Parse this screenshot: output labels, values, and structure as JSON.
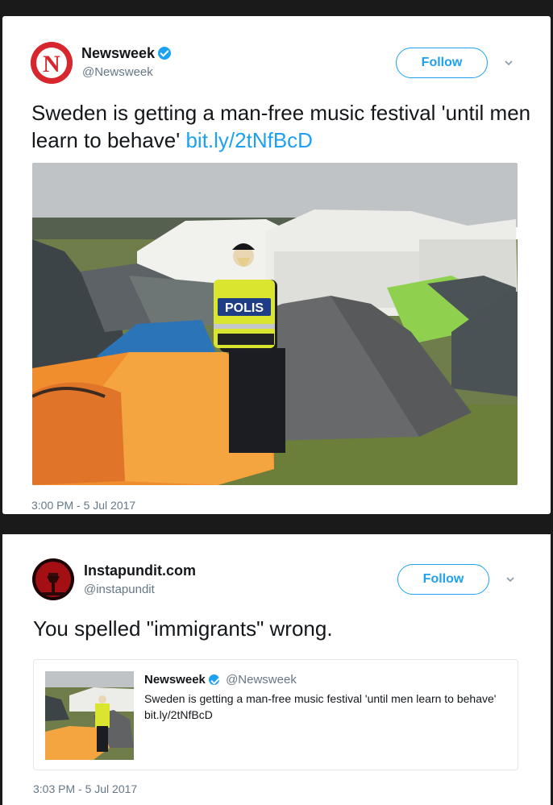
{
  "tweet1": {
    "name": "Newsweek",
    "handle": "@Newsweek",
    "avatar_letter": "N",
    "follow_label": "Follow",
    "text": "Sweden is getting a man-free music festival 'until men learn to behave'",
    "link": "bit.ly/2tNfBcD",
    "photo_badge": "POLIS",
    "timestamp": "3:00 PM - 5 Jul 2017"
  },
  "tweet2": {
    "name": "Instapundit.com",
    "handle": "@instapundit",
    "follow_label": "Follow",
    "text": "You spelled \"immigrants\" wrong.",
    "timestamp": "3:03 PM - 5 Jul 2017",
    "quoted": {
      "name": "Newsweek",
      "handle": "@Newsweek",
      "text": "Sweden is getting a man-free music festival 'until men learn to behave' bit.ly/2tNfBcD"
    }
  },
  "colors": {
    "accent": "#1da1f2",
    "newsweek_red": "#d8262e",
    "text": "#14171a",
    "muted": "#657786"
  },
  "icons": [
    "verified-badge-icon",
    "chevron-down-icon"
  ]
}
